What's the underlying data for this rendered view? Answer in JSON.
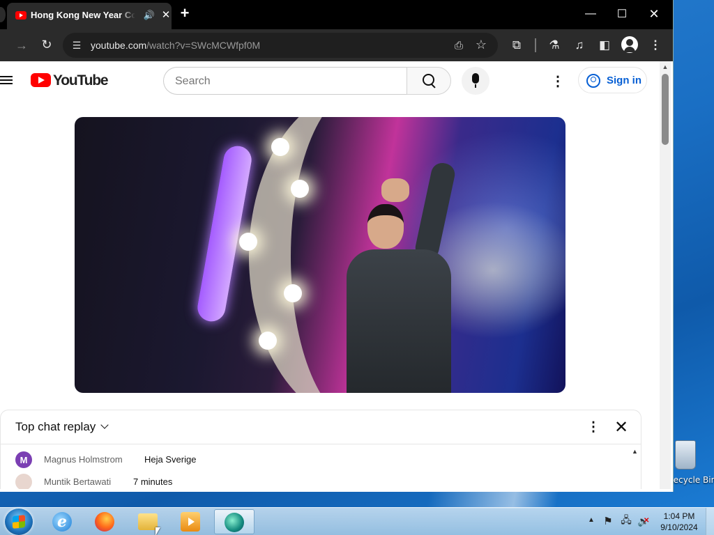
{
  "desktop": {
    "recycle_bin_label": "Recycle Bin"
  },
  "browser": {
    "tab": {
      "title": "Hong Kong New Year Countdown",
      "audio_icon": "speaker-icon",
      "close_icon": "close-icon"
    },
    "new_tab_icon": "plus-icon",
    "window_controls": {
      "minimize": "—",
      "maximize": "☐",
      "close": "✕"
    },
    "address_bar": {
      "domain": "youtube.com",
      "path": "/watch?v=SWcMCWfpf0M"
    },
    "toolbar_icons": [
      "forward-icon",
      "reload-icon",
      "install-icon",
      "bookmark-star-icon",
      "extensions-icon",
      "labs-icon",
      "media-control-icon",
      "side-panel-icon",
      "profile-icon",
      "menu-icon"
    ]
  },
  "youtube": {
    "logo_text": "YouTube",
    "search": {
      "placeholder": "Search",
      "value": ""
    },
    "sign_in_label": "Sign in",
    "brand_color": "#ff0000",
    "link_color": "#065fd4"
  },
  "chat": {
    "mode_label": "Top chat replay",
    "messages": [
      {
        "avatar_letter": "M",
        "avatar_color": "#7b3fb3",
        "author": "Magnus Holmstrom",
        "text": "Heja Sverige"
      },
      {
        "avatar_letter": "",
        "avatar_color": "#e8d6cf",
        "author": "Muntik Bertawati",
        "text": "7 minutes"
      }
    ]
  },
  "taskbar": {
    "apps": [
      "internet-explorer",
      "firefox",
      "windows-explorer",
      "media-player",
      "active-app"
    ],
    "clock": {
      "time": "1:04 PM",
      "date": "9/10/2024"
    }
  }
}
